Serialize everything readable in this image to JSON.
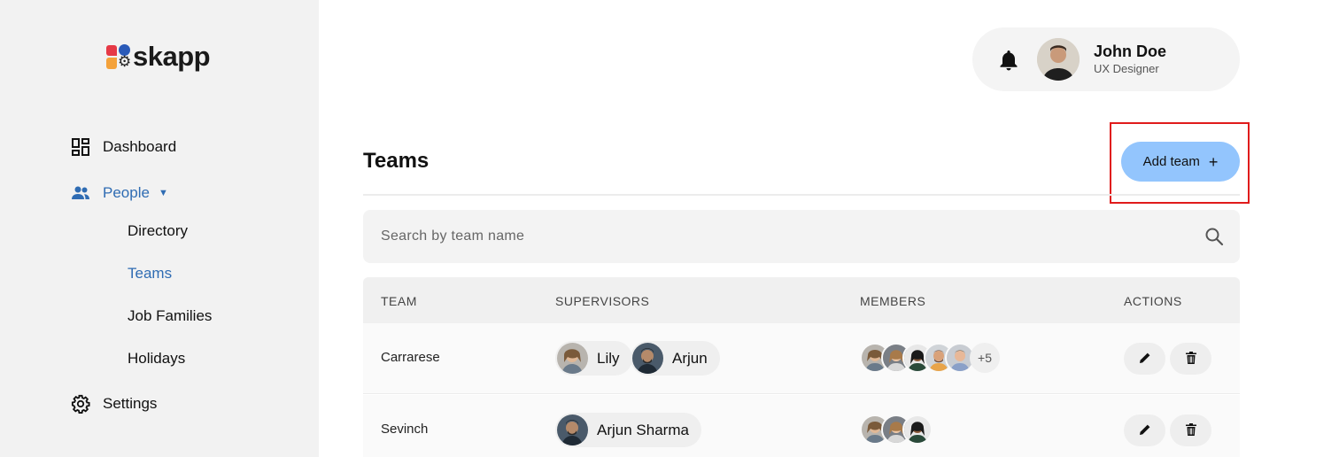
{
  "app": {
    "logo_text": "skapp",
    "colors": {
      "accent": "#2f6cb3",
      "button": "#93c5fd",
      "highlight": "#e01b1b",
      "sidebar_bg": "#f2f2f2"
    }
  },
  "sidebar": {
    "items": [
      {
        "label": "Dashboard",
        "icon": "dashboard-icon"
      },
      {
        "label": "People",
        "icon": "people-icon",
        "expanded": true
      },
      {
        "label": "Settings",
        "icon": "gear-icon"
      }
    ],
    "people_sub": [
      {
        "label": "Directory"
      },
      {
        "label": "Teams",
        "active": true
      },
      {
        "label": "Job Families"
      },
      {
        "label": "Holidays"
      }
    ]
  },
  "user": {
    "name": "John Doe",
    "role": "UX Designer"
  },
  "page": {
    "title": "Teams",
    "add_button_label": "Add team",
    "add_button_icon": "plus-icon"
  },
  "search": {
    "placeholder": "Search by team name"
  },
  "table": {
    "columns": [
      "TEAM",
      "SUPERVISORS",
      "MEMBERS",
      "ACTIONS"
    ],
    "rows": [
      {
        "team": "Carrarese",
        "supervisors": [
          "Lily",
          "Arjun"
        ],
        "members_more": "+5"
      },
      {
        "team": "Sevinch",
        "supervisors": [
          "Arjun Sharma"
        ],
        "members_more": ""
      }
    ]
  }
}
